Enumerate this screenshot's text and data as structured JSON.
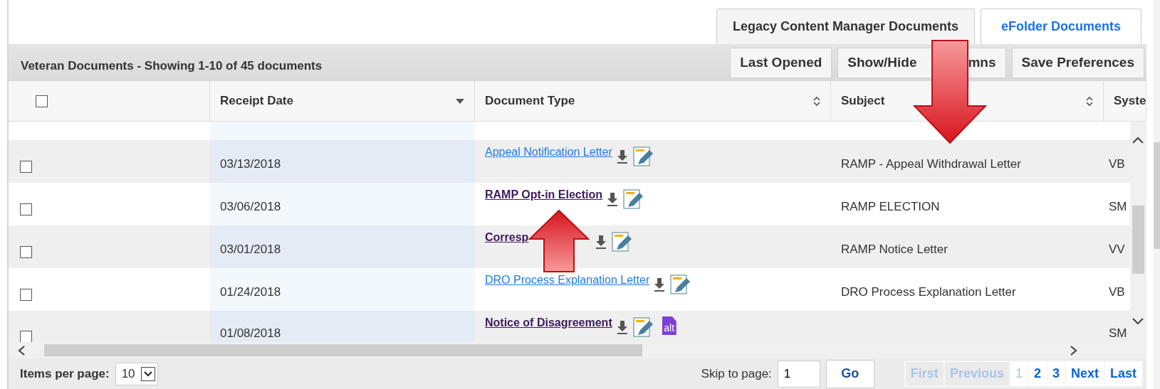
{
  "tabs": [
    {
      "label": "Legacy Content Manager Documents",
      "selected": false
    },
    {
      "label": "eFolder Documents",
      "selected": true
    }
  ],
  "header": {
    "title": "Veteran Documents - Showing 1-10 of 45 documents",
    "buttons": [
      [
        "Last Opened"
      ],
      [
        "Show/Hide",
        "mns"
      ],
      [
        "Save Preferences"
      ]
    ]
  },
  "table": {
    "select_all": {
      "checked": false
    },
    "columns": [
      {
        "label": "Receipt Date",
        "kind": "sorted"
      },
      {
        "label": "Document Type",
        "kind": "sortable"
      },
      {
        "label": "Subject",
        "kind": "sortable"
      },
      {
        "label": "Syste",
        "kind": "plain"
      }
    ],
    "rows": [
      {
        "checked": false,
        "receipt_date": "03/13/2018",
        "document_type": "Appeal Notification Letter",
        "visited": false,
        "icons": [
          {
            "kind": "download"
          },
          {
            "kind": "edit"
          }
        ],
        "subject": "RAMP - Appeal Withdrawal Letter",
        "system": "VB"
      },
      {
        "checked": false,
        "receipt_date": "03/06/2018",
        "document_type": "RAMP Opt-in Election",
        "visited": true,
        "icons": [
          {
            "kind": "download"
          },
          {
            "kind": "edit"
          }
        ],
        "subject": "RAMP ELECTION",
        "system": "SM"
      },
      {
        "checked": false,
        "receipt_date": "03/01/2018",
        "document_type": "Corresp",
        "visited": true,
        "covered": true,
        "icons": [
          {
            "kind": "download"
          },
          {
            "kind": "edit"
          }
        ],
        "subject": "RAMP Notice Letter",
        "system": "VV"
      },
      {
        "checked": false,
        "receipt_date": "01/24/2018",
        "document_type": "DRO Process Explanation Letter",
        "visited": false,
        "icons": [
          {
            "kind": "download"
          },
          {
            "kind": "edit"
          }
        ],
        "subject": "DRO Process Explanation Letter",
        "system": "VB"
      },
      {
        "checked": false,
        "receipt_date": "01/08/2018",
        "document_type": "Notice of Disagreement",
        "visited": true,
        "icons": [
          {
            "kind": "download"
          },
          {
            "kind": "edit"
          },
          {
            "kind": "alt",
            "label": "alt"
          }
        ],
        "system": "SM"
      }
    ]
  },
  "footer": {
    "items_per_page_label": "Items per page:",
    "items_per_page": "10",
    "skip_label": "Skip to page:",
    "skip_value": "1",
    "go": "Go",
    "pages": [
      {
        "label": "First",
        "disabled": true,
        "selected": false
      },
      {
        "label": "Previous",
        "disabled": true,
        "selected": false
      },
      {
        "label": "1",
        "disabled": false,
        "selected": true
      },
      {
        "label": "2",
        "disabled": false,
        "selected": false
      },
      {
        "label": "3",
        "disabled": false,
        "selected": false
      },
      {
        "label": "Next",
        "disabled": false,
        "selected": false
      },
      {
        "label": "Last",
        "disabled": false,
        "selected": false
      }
    ]
  }
}
